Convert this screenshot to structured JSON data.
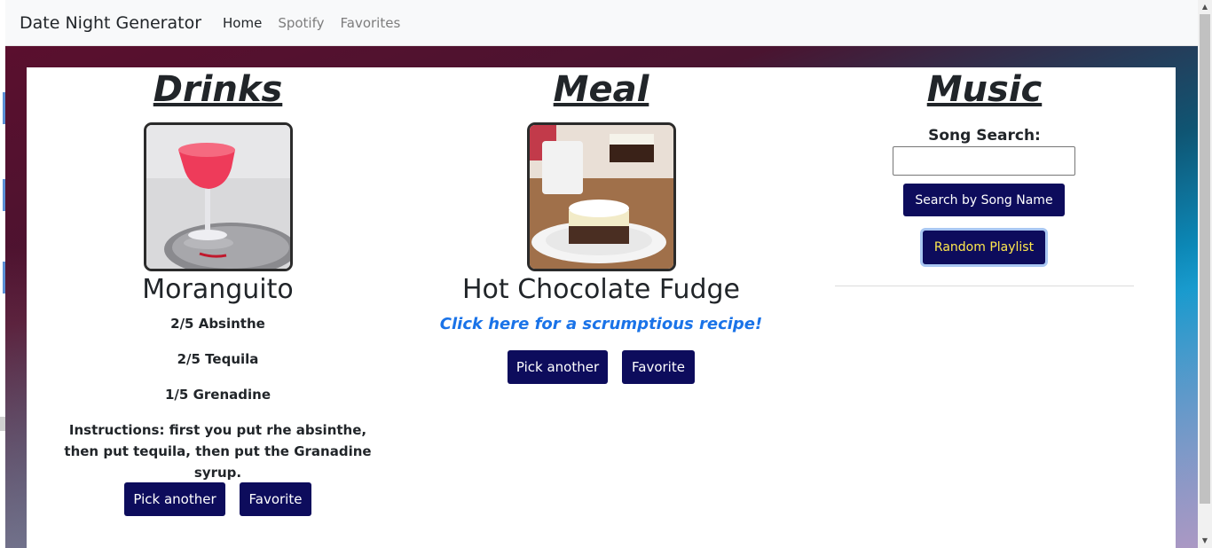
{
  "navbar": {
    "brand": "Date Night Generator",
    "links": [
      {
        "label": "Home",
        "active": true
      },
      {
        "label": "Spotify",
        "active": false
      },
      {
        "label": "Favorites",
        "active": false
      }
    ]
  },
  "drinks": {
    "title": "Drinks",
    "image_icon": "cocktail-photo",
    "name": "Moranguito",
    "ingredients": [
      "2/5 Absinthe",
      "2/5 Tequila",
      "1/5 Grenadine"
    ],
    "instructions": "Instructions: first you put rhe absinthe, then put tequila, then put the Granadine syrup.",
    "pick_label": "Pick another",
    "favorite_label": "Favorite"
  },
  "meal": {
    "title": "Meal",
    "image_icon": "fudge-photo",
    "name": "Hot Chocolate Fudge",
    "recipe_link": "Click here for a scrumptious recipe!",
    "pick_label": "Pick another",
    "favorite_label": "Favorite"
  },
  "music": {
    "title": "Music",
    "song_search_label": "Song Search:",
    "song_search_value": "",
    "search_button": "Search by Song Name",
    "random_button": "Random Playlist"
  },
  "colors": {
    "button_bg": "#0d0c5c",
    "random_text": "#ffe94d",
    "link": "#1a73e8"
  }
}
